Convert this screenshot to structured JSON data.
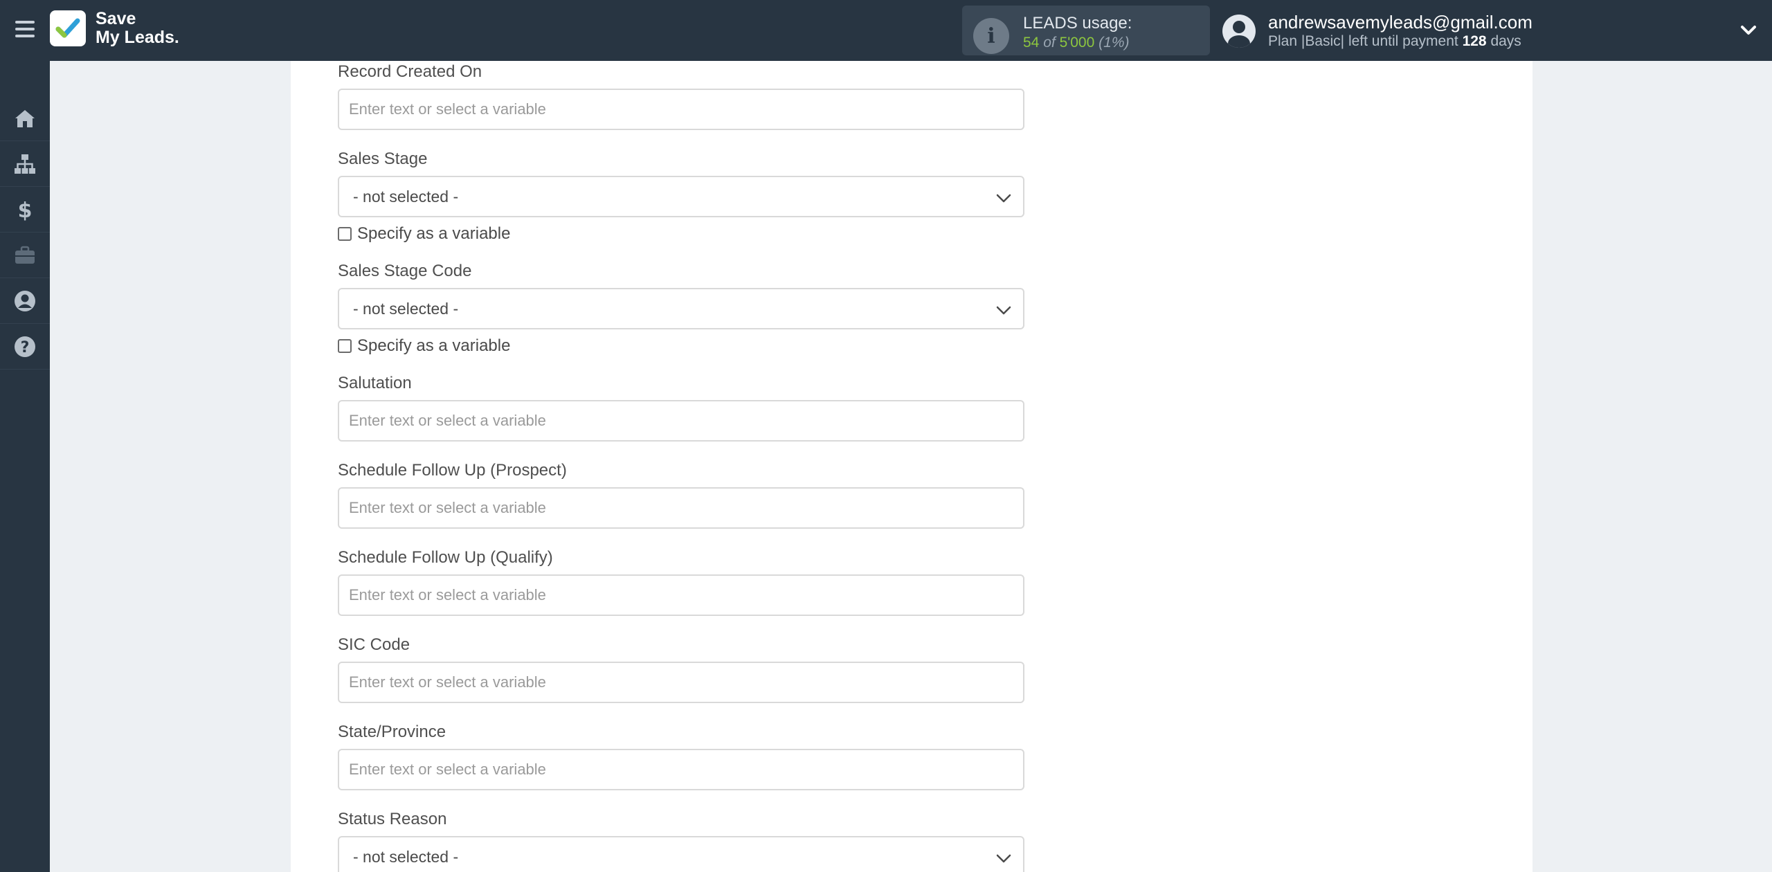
{
  "header": {
    "logo_line1": "Save",
    "logo_line2": "My Leads.",
    "usage_title": "LEADS usage:",
    "usage_used": "54",
    "usage_of": "of",
    "usage_total": "5'000",
    "usage_percent": "(1%)",
    "account_email": "andrewsavemyleads@gmail.com",
    "plan_prefix": "Plan |Basic| left until payment",
    "plan_days": "128",
    "plan_suffix": "days"
  },
  "sidebar": {
    "items": [
      {
        "icon": "home-icon"
      },
      {
        "icon": "sitemap-icon"
      },
      {
        "icon": "dollar-icon"
      },
      {
        "icon": "briefcase-icon"
      },
      {
        "icon": "user-circle-icon"
      },
      {
        "icon": "help-icon"
      }
    ]
  },
  "form": {
    "placeholder": "Enter text or select a variable",
    "not_selected": "- not selected -",
    "specify_variable": "Specify as a variable",
    "fields": {
      "record_created_on": "Record Created On",
      "sales_stage": "Sales Stage",
      "sales_stage_code": "Sales Stage Code",
      "salutation": "Salutation",
      "schedule_follow_up_prospect": "Schedule Follow Up (Prospect)",
      "schedule_follow_up_qualify": "Schedule Follow Up (Qualify)",
      "sic_code": "SIC Code",
      "state_province": "State/Province",
      "status_reason": "Status Reason"
    }
  },
  "colors": {
    "topbar": "#283542",
    "accent_green": "#8dc63f",
    "page_bg": "#edf0f3"
  }
}
